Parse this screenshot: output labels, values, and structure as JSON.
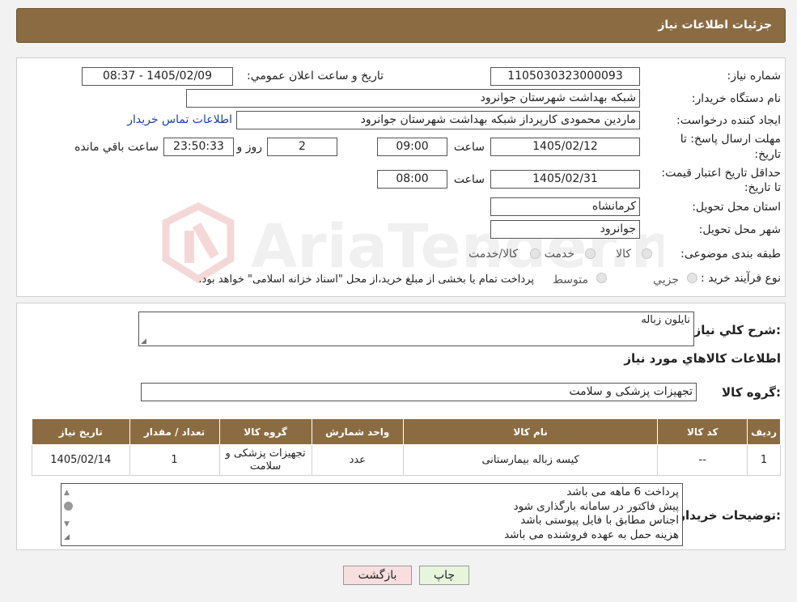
{
  "header": {
    "title": "جزئیات اطلاعات نیاز"
  },
  "info": {
    "need_number_label": "شماره نیاز:",
    "need_number": "1105030323000093",
    "announce_label": "تاریخ و ساعت اعلان عمومي:",
    "announce_value": "1405/02/09 - 08:37",
    "buyer_org_label": "نام دستگاه خريدار:",
    "buyer_org": "شبکه بهداشت شهرستان جوانرود",
    "creator_label": "ايجاد کننده درخواست:",
    "creator": "ماردین محمودی کارپرداز شبکه بهداشت شهرستان جوانرود",
    "contact_link": "اطلاعات تماس خريدار",
    "deadline_label": "مهلت ارسال پاسخ: تا تاريخ:",
    "deadline_date": "1405/02/12",
    "time_label": "ساعت",
    "deadline_time": "09:00",
    "days": "2",
    "days_label": "روز و",
    "remaining": "23:50:33",
    "remaining_label": "ساعت باقي مانده",
    "validity_label": "حداقل تاريخ اعتبار قيمت: تا تاريخ:",
    "validity_date": "1405/02/31",
    "validity_time": "08:00",
    "province_label": "استان محل تحويل:",
    "province": "کرمانشاه",
    "city_label": "شهر محل تحويل:",
    "city": "جوانرود",
    "category_label": "طبقه بندی موضوعی:",
    "category_options": [
      "کالا",
      "خدمت",
      "کالا/خدمت"
    ],
    "process_label": "نوع فرآيند خريد :",
    "process_options": [
      "جزيي",
      "متوسط"
    ],
    "process_note": "پرداخت تمام يا بخشی از مبلغ خريد،از محل \"اسناد خزانه اسلامی\" خواهد بود."
  },
  "details": {
    "general_desc_label": "شرح کلي نياز:",
    "general_desc": "نایلون زباله",
    "goods_info_title": "اطلاعات کالاهاي مورد نياز",
    "goods_group_label": "گروه کالا:",
    "goods_group": "تجهیزات پزشکی و سلامت"
  },
  "table": {
    "headers": [
      "رديف",
      "کد کالا",
      "نام کالا",
      "واحد شمارش",
      "گروه کالا",
      "تعداد / مقدار",
      "تاريخ نياز"
    ],
    "rows": [
      [
        "1",
        "--",
        "کیسه زباله بیمارستانی",
        "عدد",
        "تجهیزات پزشکی و سلامت",
        "1",
        "1405/02/14"
      ]
    ]
  },
  "buyer_notes": {
    "label": "توضيحات خريدار:",
    "lines": [
      "پرداخت 6 ماهه می باشد",
      "پیش فاکتور در سامانه بارگذاری شود",
      "اجناس مطابق با فایل پیوستی باشد",
      "هزینه حمل به عهده فروشنده می باشد"
    ]
  },
  "buttons": {
    "print": "چاپ",
    "back": "بازگشت"
  },
  "watermark": "AriaTender.neT",
  "colors": {
    "header_bg": "#8b6c42",
    "link": "#1b3fa8",
    "back_btn_bg": "#f8dede",
    "print_btn_bg": "#e6f5dc"
  }
}
